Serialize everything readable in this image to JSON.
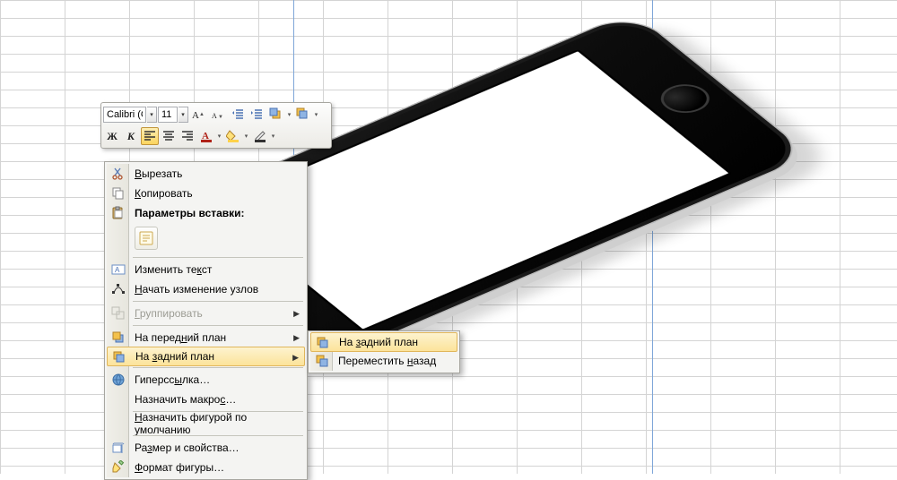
{
  "mini_toolbar": {
    "font_name": "Calibri (С",
    "font_size": "11"
  },
  "context_menu": {
    "cut": "Вырезать",
    "copy": "Копировать",
    "paste_options_header": "Параметры вставки:",
    "edit_text": "Изменить текст",
    "edit_points": "Начать изменение узлов",
    "group": "Группировать",
    "bring_front": "На передний план",
    "send_back": "На задний план",
    "hyperlink": "Гиперссылка…",
    "assign_macro": "Назначить макрос…",
    "set_default_shape": "Назначить фигурой по умолчанию",
    "size_properties": "Размер и свойства…",
    "format_shape": "Формат фигуры…"
  },
  "submenu": {
    "send_to_back": "На задний план",
    "send_backward": "Переместить назад"
  }
}
